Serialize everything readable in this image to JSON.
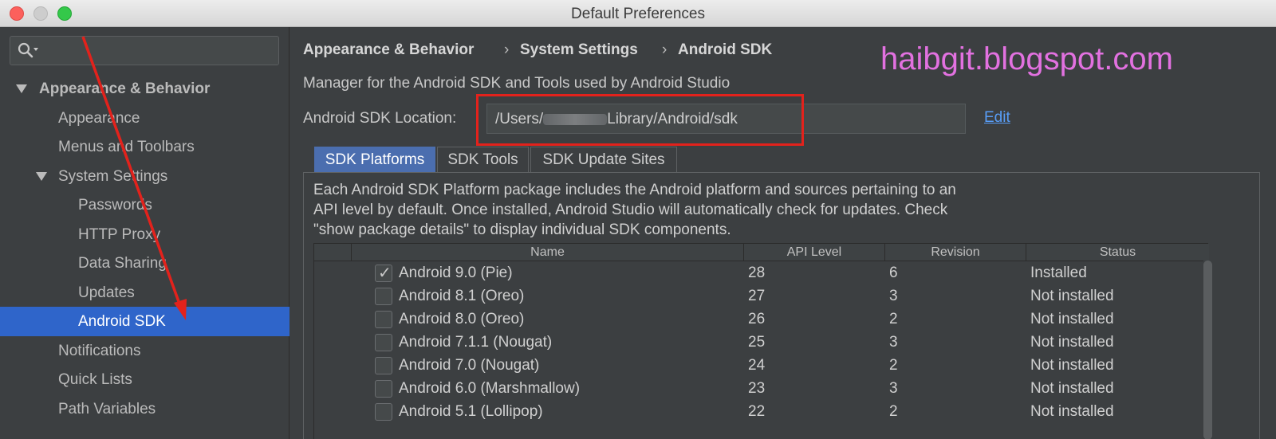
{
  "window": {
    "title": "Default Preferences"
  },
  "sidebar": {
    "search_placeholder": "",
    "items": [
      {
        "label": "Appearance & Behavior"
      },
      {
        "label": "Appearance"
      },
      {
        "label": "Menus and Toolbars"
      },
      {
        "label": "System Settings"
      },
      {
        "label": "Passwords"
      },
      {
        "label": "HTTP Proxy"
      },
      {
        "label": "Data Sharing"
      },
      {
        "label": "Updates"
      },
      {
        "label": "Android SDK"
      },
      {
        "label": "Notifications"
      },
      {
        "label": "Quick Lists"
      },
      {
        "label": "Path Variables"
      }
    ]
  },
  "main": {
    "breadcrumb": [
      "Appearance & Behavior",
      "System Settings",
      "Android SDK"
    ],
    "breadcrumb_sep": "›",
    "watermark": "haibgit.blogspot.com",
    "description": "Manager for the Android SDK and Tools used by Android Studio",
    "sdk_location_label": "Android SDK Location:",
    "sdk_location_prefix": "/Users/",
    "sdk_location_suffix": "Library/Android/sdk",
    "edit_label": "Edit",
    "tabs": [
      {
        "label": "SDK Platforms"
      },
      {
        "label": "SDK Tools"
      },
      {
        "label": "SDK Update Sites"
      }
    ],
    "panel_text": [
      "Each Android SDK Platform package includes the Android platform and sources pertaining to an",
      "API level by default. Once installed, Android Studio will automatically check for updates. Check",
      "\"show package details\" to display individual SDK components."
    ],
    "table": {
      "headers": [
        "Name",
        "API Level",
        "Revision",
        "Status"
      ],
      "rows": [
        {
          "name": "Android 9.0 (Pie)",
          "api": "28",
          "revision": "6",
          "status": "Installed",
          "checked": true
        },
        {
          "name": "Android 8.1 (Oreo)",
          "api": "27",
          "revision": "3",
          "status": "Not installed",
          "checked": false
        },
        {
          "name": "Android 8.0 (Oreo)",
          "api": "26",
          "revision": "2",
          "status": "Not installed",
          "checked": false
        },
        {
          "name": "Android 7.1.1 (Nougat)",
          "api": "25",
          "revision": "3",
          "status": "Not installed",
          "checked": false
        },
        {
          "name": "Android 7.0 (Nougat)",
          "api": "24",
          "revision": "2",
          "status": "Not installed",
          "checked": false
        },
        {
          "name": "Android 6.0 (Marshmallow)",
          "api": "23",
          "revision": "3",
          "status": "Not installed",
          "checked": false
        },
        {
          "name": "Android 5.1 (Lollipop)",
          "api": "22",
          "revision": "2",
          "status": "Not installed",
          "checked": false
        }
      ]
    }
  },
  "colors": {
    "accent_selected": "#2f65ca",
    "active_tab": "#4b6eaf",
    "annotation_red": "#e3221c",
    "watermark": "#e271e0",
    "link": "#589df6"
  }
}
